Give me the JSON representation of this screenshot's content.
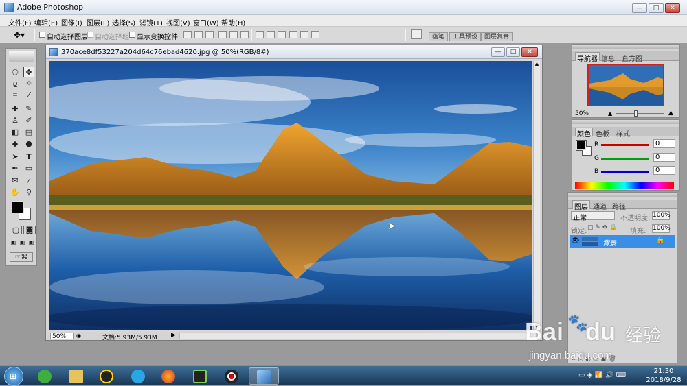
{
  "window": {
    "title": "Adobe Photoshop",
    "minimize": "—",
    "maximize": "□",
    "close": "✕"
  },
  "menu": [
    "文件(F)",
    "编辑(E)",
    "图像(I)",
    "图层(L)",
    "选择(S)",
    "滤镜(T)",
    "视图(V)",
    "窗口(W)",
    "帮助(H)"
  ],
  "options": {
    "auto_select_layer": "自动选择图层",
    "auto_select_group": "自动选择组",
    "show_transform_controls": "显示变换控件",
    "palette_tabs": [
      "画笔",
      "工具预设",
      "图层复合"
    ]
  },
  "document": {
    "title": "370ace8df53227a204d64c76ebad4620.jpg @ 50%(RGB/8#)",
    "zoom": "50%",
    "doc_size": "文档:5.93M/5.93M"
  },
  "navigator": {
    "tabs": [
      "导航器",
      "信息",
      "直方图"
    ],
    "zoom": "50%"
  },
  "color": {
    "tabs": [
      "颜色",
      "色板",
      "样式"
    ],
    "channels": [
      {
        "label": "R",
        "value": "0"
      },
      {
        "label": "G",
        "value": "0"
      },
      {
        "label": "B",
        "value": "0"
      }
    ]
  },
  "layers": {
    "tabs": [
      "图层",
      "通道",
      "路径"
    ],
    "blend_mode": "正常",
    "opacity_label": "不透明度:",
    "opacity": "100%",
    "lock_label": "锁定:",
    "fill_label": "填充:",
    "fill": "100%",
    "items": [
      {
        "name": "背景"
      }
    ]
  },
  "taskbar": {
    "time": "21:30",
    "date": "2018/9/28"
  },
  "watermark": {
    "brand": "Bai",
    "brand2": "du",
    "text": "经验",
    "url": "jingyan.baidu.com"
  },
  "colors": {
    "accent": "#3a78c9",
    "layer_selected": "#3a8ee6",
    "red": "#cc0000",
    "green": "#00a000",
    "blue": "#0000cc"
  }
}
